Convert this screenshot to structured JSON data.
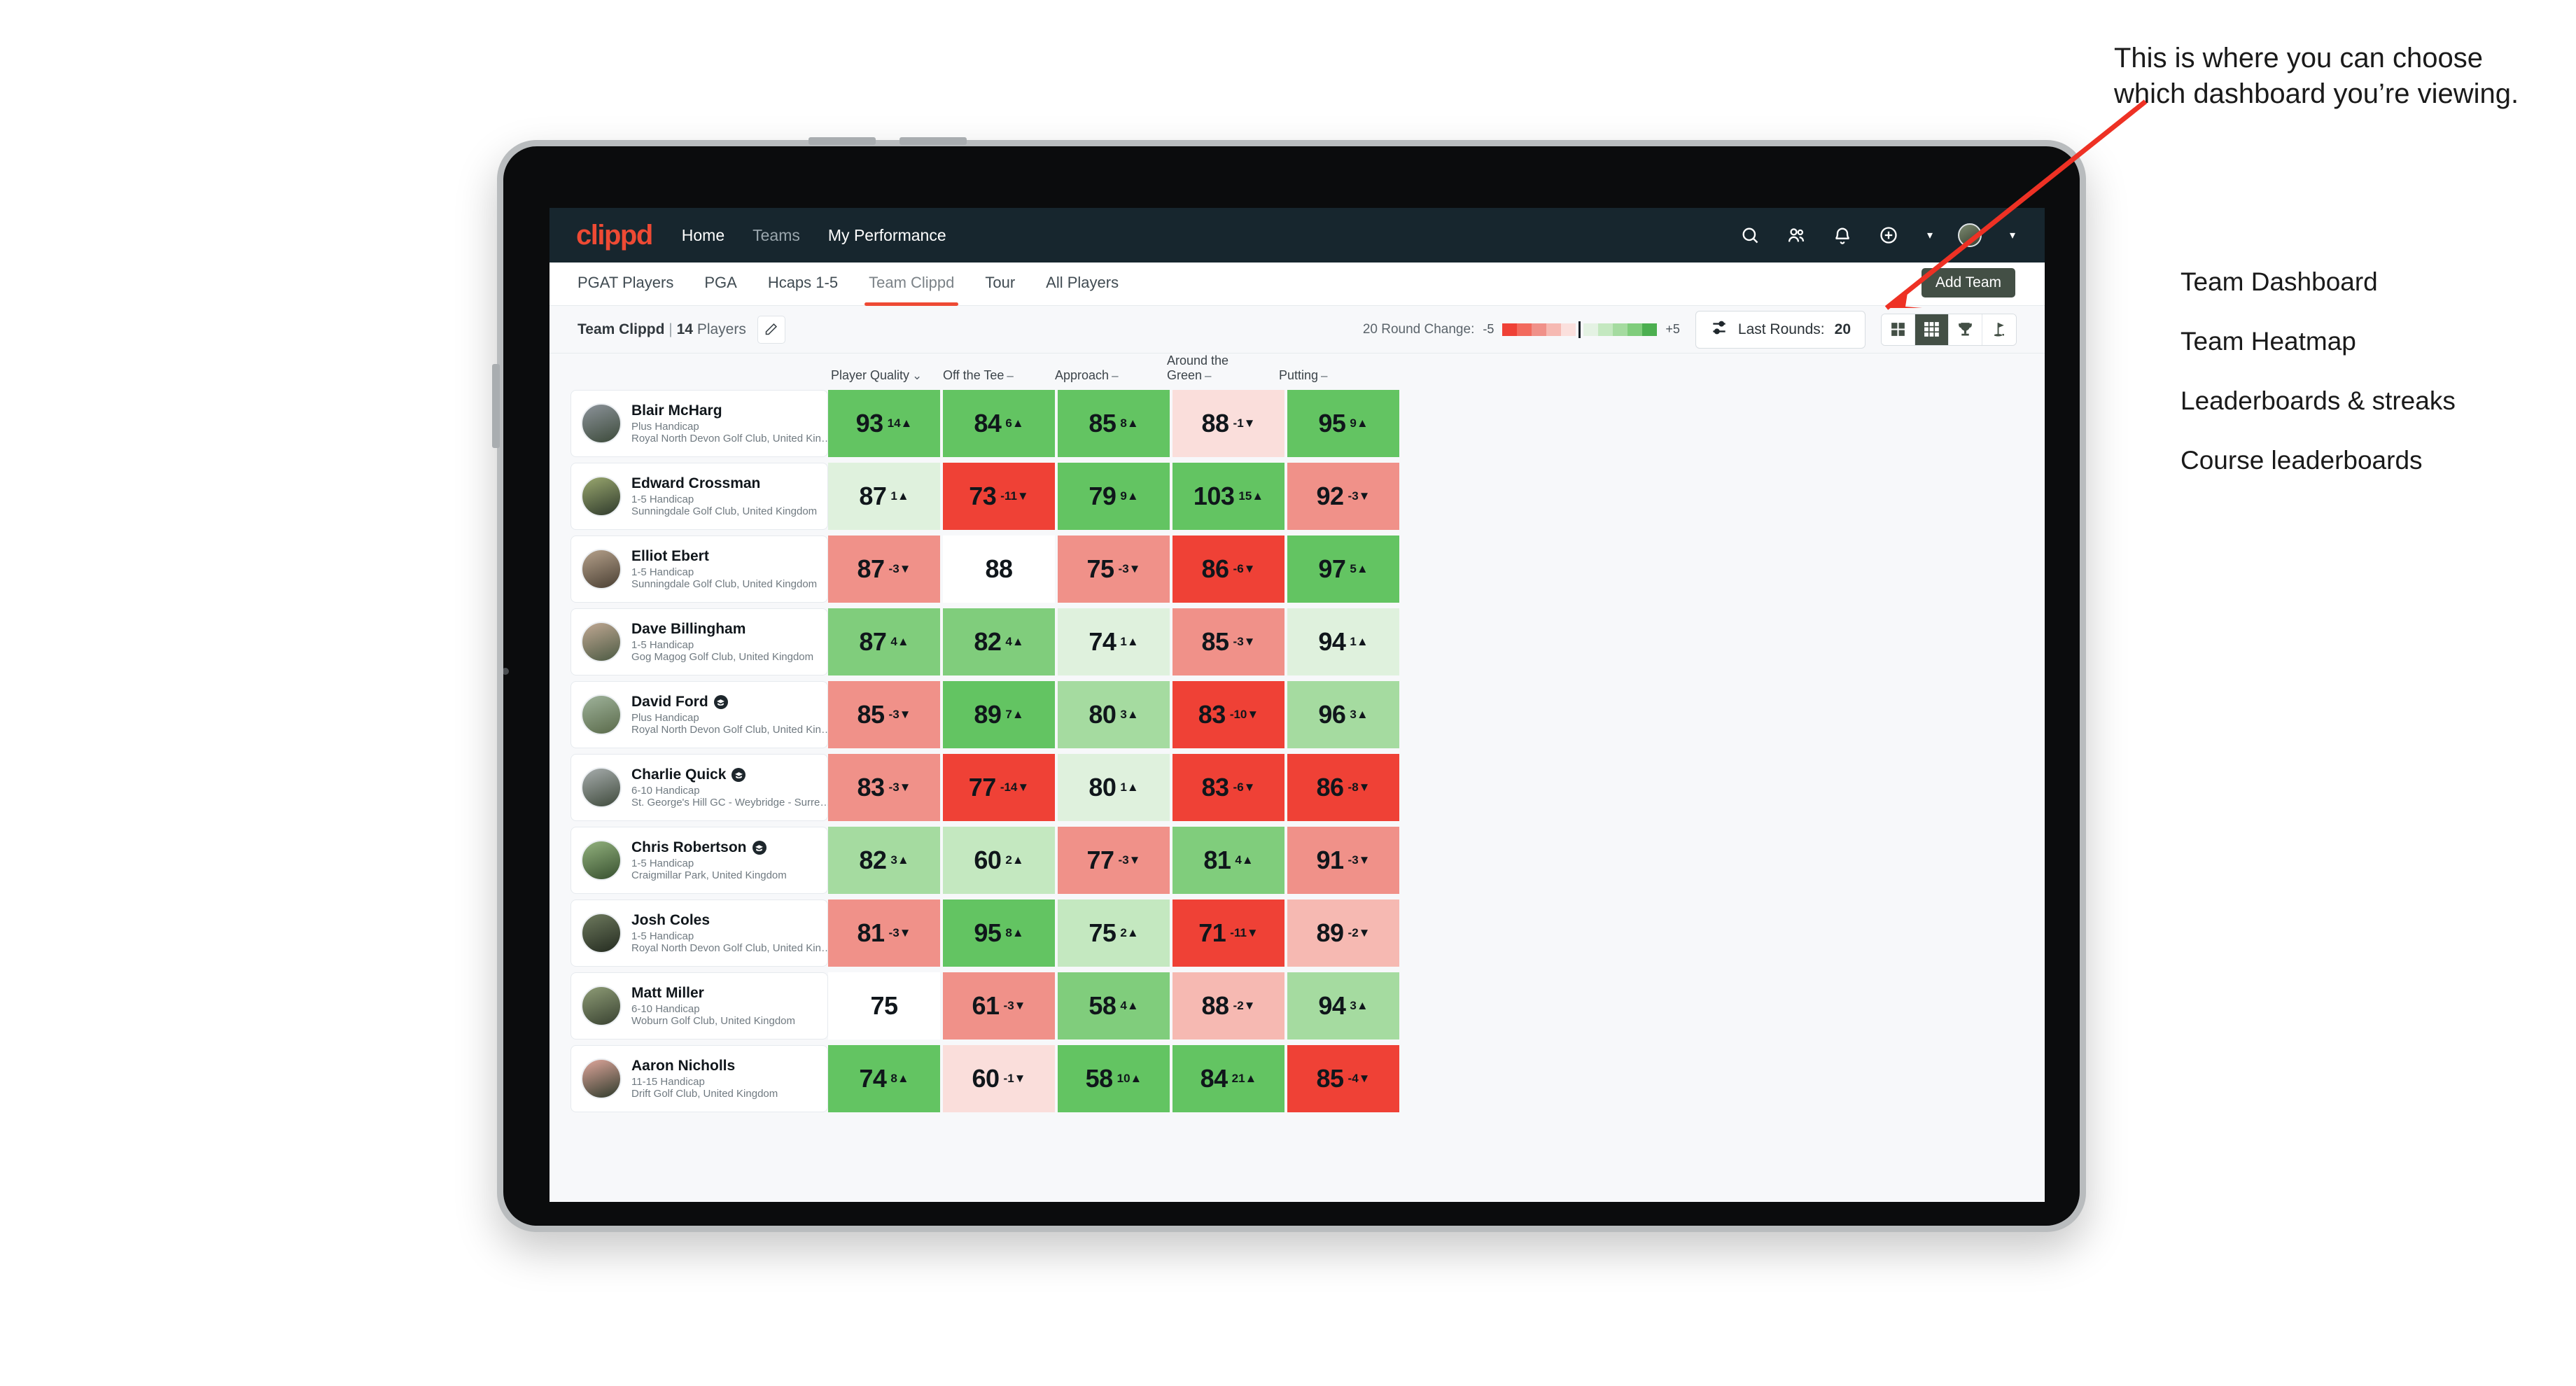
{
  "navbar": {
    "logo": "clippd",
    "links": [
      {
        "label": "Home",
        "active": true
      },
      {
        "label": "Teams",
        "active": false
      },
      {
        "label": "My Performance",
        "active": true
      }
    ],
    "icons": [
      "search-icon",
      "people-icon",
      "bell-icon",
      "plus-circle-icon",
      "avatar"
    ]
  },
  "tabs": [
    {
      "label": "PGAT Players",
      "active": false
    },
    {
      "label": "PGA",
      "active": false
    },
    {
      "label": "Hcaps 1-5",
      "active": false
    },
    {
      "label": "Team Clippd",
      "active": true
    },
    {
      "label": "Tour",
      "active": false
    },
    {
      "label": "All Players",
      "active": false
    }
  ],
  "add_team_label": "Add Team",
  "toolbar": {
    "team_name": "Team Clippd",
    "separator": "|",
    "player_count": "14",
    "players_word": "Players",
    "edit_icon": "pencil-icon",
    "round_change_label": "20 Round Change:",
    "scale_min": "-5",
    "scale_max": "+5",
    "last_rounds_label": "Last Rounds:",
    "last_rounds_value": "20",
    "filter_icon": "sliders-icon"
  },
  "view_toggles": [
    {
      "name": "team-dashboard",
      "icon": "grid-2x2-icon",
      "active": false
    },
    {
      "name": "team-heatmap",
      "icon": "grid-3x3-icon",
      "active": true
    },
    {
      "name": "leaderboards-streaks",
      "icon": "trophy-icon",
      "active": false
    },
    {
      "name": "course-leaderboards",
      "icon": "golf-flag-icon",
      "active": false
    }
  ],
  "columns": [
    {
      "label": "Player Quality",
      "marker": "chevron-down-icon",
      "glyph": "⌄"
    },
    {
      "label": "Off the Tee",
      "marker": "dash-icon",
      "glyph": "–"
    },
    {
      "label": "Approach",
      "marker": "dash-icon",
      "glyph": "–"
    },
    {
      "label": "Around the Green",
      "marker": "dash-icon",
      "glyph": "–"
    },
    {
      "label": "Putting",
      "marker": "dash-icon",
      "glyph": "–"
    }
  ],
  "chart_data": {
    "type": "heatmap",
    "title": "Team Clippd — Team Heatmap",
    "columns": [
      "Player Quality",
      "Off the Tee",
      "Approach",
      "Around the Green",
      "Putting"
    ],
    "rows": [
      {
        "player": "Blair McHarg",
        "values": [
          93,
          84,
          85,
          88,
          95
        ],
        "deltas": [
          14,
          6,
          8,
          -1,
          9
        ]
      },
      {
        "player": "Edward Crossman",
        "values": [
          87,
          73,
          79,
          103,
          92
        ],
        "deltas": [
          1,
          -11,
          9,
          15,
          -3
        ]
      },
      {
        "player": "Elliot Ebert",
        "values": [
          87,
          88,
          75,
          86,
          97
        ],
        "deltas": [
          -3,
          null,
          -3,
          -6,
          5
        ]
      },
      {
        "player": "Dave Billingham",
        "values": [
          87,
          82,
          74,
          85,
          94
        ],
        "deltas": [
          4,
          4,
          1,
          -3,
          1
        ]
      },
      {
        "player": "David Ford",
        "values": [
          85,
          89,
          80,
          83,
          96
        ],
        "deltas": [
          -3,
          7,
          3,
          -10,
          3
        ]
      },
      {
        "player": "Charlie Quick",
        "values": [
          83,
          77,
          80,
          83,
          86
        ],
        "deltas": [
          -3,
          -14,
          1,
          -6,
          -8
        ]
      },
      {
        "player": "Chris Robertson",
        "values": [
          82,
          60,
          77,
          81,
          91
        ],
        "deltas": [
          3,
          2,
          -3,
          4,
          -3
        ]
      },
      {
        "player": "Josh Coles",
        "values": [
          81,
          95,
          75,
          71,
          89
        ],
        "deltas": [
          -3,
          8,
          2,
          -11,
          -2
        ]
      },
      {
        "player": "Matt Miller",
        "values": [
          75,
          61,
          58,
          88,
          94
        ],
        "deltas": [
          null,
          -3,
          4,
          -2,
          3
        ]
      },
      {
        "player": "Aaron Nicholls",
        "values": [
          74,
          60,
          58,
          84,
          85
        ],
        "deltas": [
          8,
          -1,
          10,
          21,
          -4
        ]
      }
    ],
    "color_scale": {
      "min_label": "-5",
      "max_label": "+5",
      "negative": [
        "#ef4136",
        "#f08a80",
        "#f5b3ab",
        "#fad5d0",
        "#fbe3e0"
      ],
      "positive": [
        "#e4f2e3",
        "#cfe9cd",
        "#a9dba5",
        "#7ecb79",
        "#5cba52"
      ]
    },
    "legend_position": "toolbar-top-right",
    "grid": false
  },
  "players": [
    {
      "name": "Blair McHarg",
      "handicap": "Plus Handicap",
      "club": "Royal North Devon Golf Club, United Kingdom",
      "verified": false,
      "avatar_from": "#8c939a",
      "avatar_to": "#3c4a3a"
    },
    {
      "name": "Edward Crossman",
      "handicap": "1-5 Handicap",
      "club": "Sunningdale Golf Club, United Kingdom",
      "verified": false,
      "avatar_from": "#9aa86f",
      "avatar_to": "#2f3a2c"
    },
    {
      "name": "Elliot Ebert",
      "handicap": "1-5 Handicap",
      "club": "Sunningdale Golf Club, United Kingdom",
      "verified": false,
      "avatar_from": "#b5a18b",
      "avatar_to": "#4a3f33"
    },
    {
      "name": "Dave Billingham",
      "handicap": "1-5 Handicap",
      "club": "Gog Magog Golf Club, United Kingdom",
      "verified": false,
      "avatar_from": "#c0a893",
      "avatar_to": "#4c5a43"
    },
    {
      "name": "David Ford",
      "handicap": "Plus Handicap",
      "club": "Royal North Devon Golf Club, United Kingdom",
      "verified": true,
      "avatar_from": "#9fb39b",
      "avatar_to": "#5a6a4a"
    },
    {
      "name": "Charlie Quick",
      "handicap": "6-10 Handicap",
      "club": "St. George's Hill GC - Weybridge - Surrey, Uni...",
      "verified": true,
      "avatar_from": "#a7adad",
      "avatar_to": "#3f4a3c"
    },
    {
      "name": "Chris Robertson",
      "handicap": "1-5 Handicap",
      "club": "Craigmillar Park, United Kingdom",
      "verified": true,
      "avatar_from": "#93b27e",
      "avatar_to": "#37502f"
    },
    {
      "name": "Josh Coles",
      "handicap": "1-5 Handicap",
      "club": "Royal North Devon Golf Club, United Kingdom",
      "verified": false,
      "avatar_from": "#6e7a5e",
      "avatar_to": "#242b20"
    },
    {
      "name": "Matt Miller",
      "handicap": "6-10 Handicap",
      "club": "Woburn Golf Club, United Kingdom",
      "verified": false,
      "avatar_from": "#8e9c76",
      "avatar_to": "#394231"
    },
    {
      "name": "Aaron Nicholls",
      "handicap": "11-15 Handicap",
      "club": "Drift Golf Club, United Kingdom",
      "verified": false,
      "avatar_from": "#e0a79c",
      "avatar_to": "#2e3a2b"
    }
  ],
  "cells": [
    [
      {
        "v": "93",
        "d": "14",
        "dir": "up",
        "bg": "#63c462"
      },
      {
        "v": "84",
        "d": "6",
        "dir": "up",
        "bg": "#63c462"
      },
      {
        "v": "85",
        "d": "8",
        "dir": "up",
        "bg": "#63c462"
      },
      {
        "v": "88",
        "d": "-1",
        "dir": "down",
        "bg": "#fadedb"
      },
      {
        "v": "95",
        "d": "9",
        "dir": "up",
        "bg": "#63c462"
      }
    ],
    [
      {
        "v": "87",
        "d": "1",
        "dir": "up",
        "bg": "#dff1dd"
      },
      {
        "v": "73",
        "d": "-11",
        "dir": "down",
        "bg": "#ef4136"
      },
      {
        "v": "79",
        "d": "9",
        "dir": "up",
        "bg": "#63c462"
      },
      {
        "v": "103",
        "d": "15",
        "dir": "up",
        "bg": "#63c462"
      },
      {
        "v": "92",
        "d": "-3",
        "dir": "down",
        "bg": "#f09189"
      }
    ],
    [
      {
        "v": "87",
        "d": "-3",
        "dir": "down",
        "bg": "#f09189"
      },
      {
        "v": "88",
        "d": "",
        "dir": "none",
        "bg": "#ffffff"
      },
      {
        "v": "75",
        "d": "-3",
        "dir": "down",
        "bg": "#f09189"
      },
      {
        "v": "86",
        "d": "-6",
        "dir": "down",
        "bg": "#ef4136"
      },
      {
        "v": "97",
        "d": "5",
        "dir": "up",
        "bg": "#63c462"
      }
    ],
    [
      {
        "v": "87",
        "d": "4",
        "dir": "up",
        "bg": "#80cd7c"
      },
      {
        "v": "82",
        "d": "4",
        "dir": "up",
        "bg": "#80cd7c"
      },
      {
        "v": "74",
        "d": "1",
        "dir": "up",
        "bg": "#dff1dd"
      },
      {
        "v": "85",
        "d": "-3",
        "dir": "down",
        "bg": "#f09189"
      },
      {
        "v": "94",
        "d": "1",
        "dir": "up",
        "bg": "#dff1dd"
      }
    ],
    [
      {
        "v": "85",
        "d": "-3",
        "dir": "down",
        "bg": "#f09189"
      },
      {
        "v": "89",
        "d": "7",
        "dir": "up",
        "bg": "#63c462"
      },
      {
        "v": "80",
        "d": "3",
        "dir": "up",
        "bg": "#a5dba0"
      },
      {
        "v": "83",
        "d": "-10",
        "dir": "down",
        "bg": "#ef4136"
      },
      {
        "v": "96",
        "d": "3",
        "dir": "up",
        "bg": "#a5dba0"
      }
    ],
    [
      {
        "v": "83",
        "d": "-3",
        "dir": "down",
        "bg": "#f09189"
      },
      {
        "v": "77",
        "d": "-14",
        "dir": "down",
        "bg": "#ef4136"
      },
      {
        "v": "80",
        "d": "1",
        "dir": "up",
        "bg": "#dff1dd"
      },
      {
        "v": "83",
        "d": "-6",
        "dir": "down",
        "bg": "#ef4136"
      },
      {
        "v": "86",
        "d": "-8",
        "dir": "down",
        "bg": "#ef4136"
      }
    ],
    [
      {
        "v": "82",
        "d": "3",
        "dir": "up",
        "bg": "#a5dba0"
      },
      {
        "v": "60",
        "d": "2",
        "dir": "up",
        "bg": "#c4e8c0"
      },
      {
        "v": "77",
        "d": "-3",
        "dir": "down",
        "bg": "#f09189"
      },
      {
        "v": "81",
        "d": "4",
        "dir": "up",
        "bg": "#80cd7c"
      },
      {
        "v": "91",
        "d": "-3",
        "dir": "down",
        "bg": "#f09189"
      }
    ],
    [
      {
        "v": "81",
        "d": "-3",
        "dir": "down",
        "bg": "#f09189"
      },
      {
        "v": "95",
        "d": "8",
        "dir": "up",
        "bg": "#63c462"
      },
      {
        "v": "75",
        "d": "2",
        "dir": "up",
        "bg": "#c4e8c0"
      },
      {
        "v": "71",
        "d": "-11",
        "dir": "down",
        "bg": "#ef4136"
      },
      {
        "v": "89",
        "d": "-2",
        "dir": "down",
        "bg": "#f6b9b2"
      }
    ],
    [
      {
        "v": "75",
        "d": "",
        "dir": "none",
        "bg": "#ffffff"
      },
      {
        "v": "61",
        "d": "-3",
        "dir": "down",
        "bg": "#f09189"
      },
      {
        "v": "58",
        "d": "4",
        "dir": "up",
        "bg": "#80cd7c"
      },
      {
        "v": "88",
        "d": "-2",
        "dir": "down",
        "bg": "#f6b9b2"
      },
      {
        "v": "94",
        "d": "3",
        "dir": "up",
        "bg": "#a5dba0"
      }
    ],
    [
      {
        "v": "74",
        "d": "8",
        "dir": "up",
        "bg": "#63c462"
      },
      {
        "v": "60",
        "d": "-1",
        "dir": "down",
        "bg": "#fadedb"
      },
      {
        "v": "58",
        "d": "10",
        "dir": "up",
        "bg": "#63c462"
      },
      {
        "v": "84",
        "d": "21",
        "dir": "up",
        "bg": "#63c462"
      },
      {
        "v": "85",
        "d": "-4",
        "dir": "down",
        "bg": "#ef4136"
      }
    ]
  ],
  "annotation": {
    "callout": "This is where you can choose which dashboard you’re viewing.",
    "items": [
      "Team Dashboard",
      "Team Heatmap",
      "Leaderboards & streaks",
      "Course leaderboards"
    ],
    "arrow_color": "#ee3124"
  }
}
